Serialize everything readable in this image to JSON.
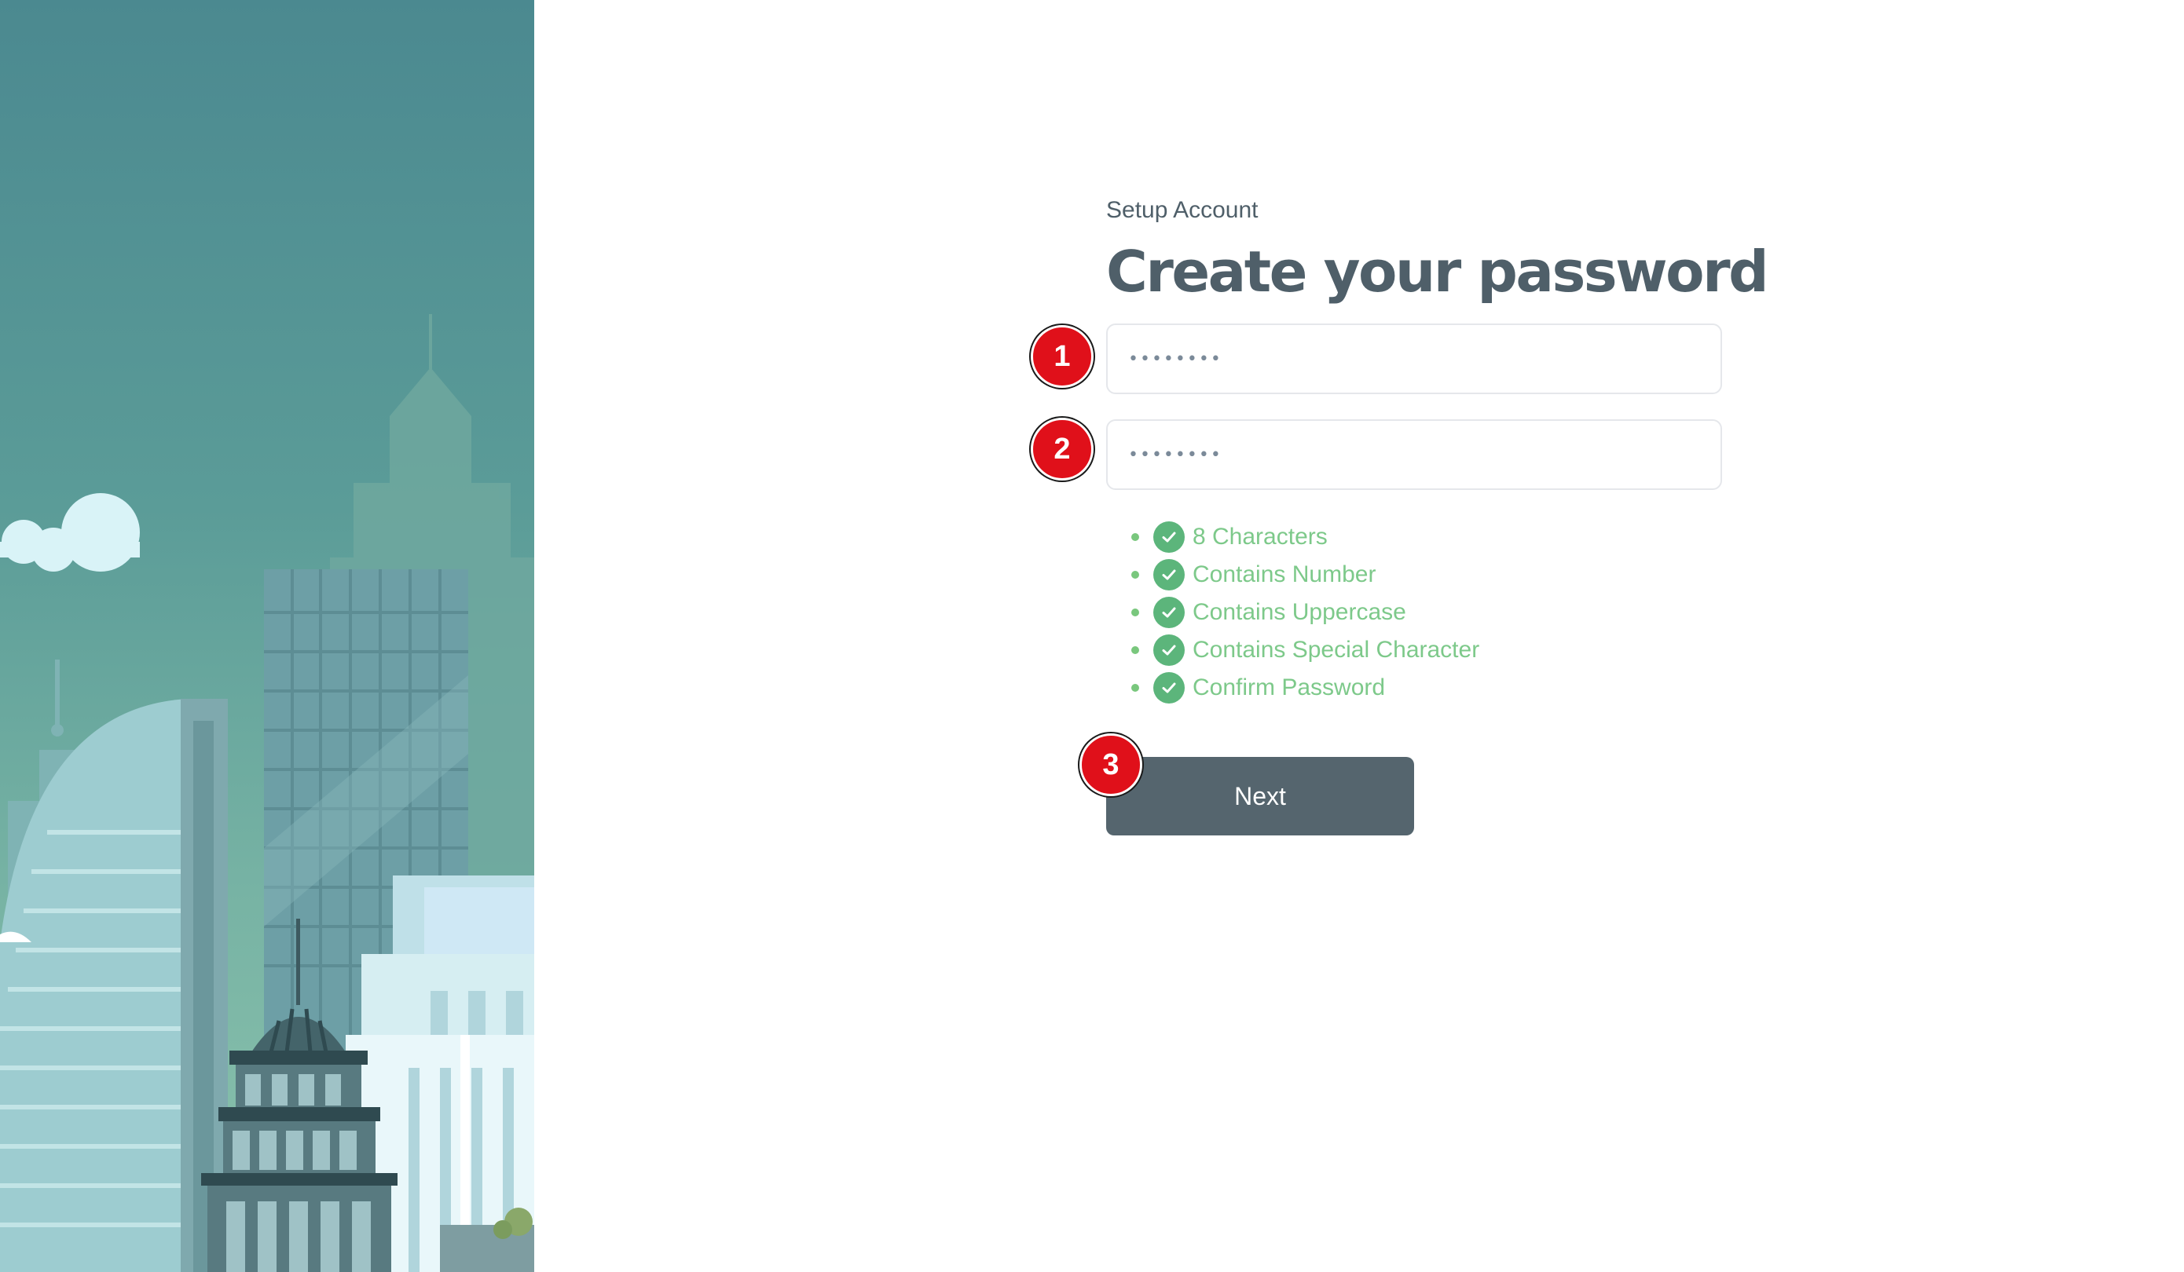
{
  "header": {
    "subtitle": "Setup Account",
    "title": "Create your password"
  },
  "fields": {
    "password_value": "••••••••",
    "confirm_value": "••••••••"
  },
  "requirements": [
    {
      "label": "8 Characters",
      "met": true
    },
    {
      "label": "Contains Number",
      "met": true
    },
    {
      "label": "Contains Uppercase",
      "met": true
    },
    {
      "label": "Contains Special Character",
      "met": true
    },
    {
      "label": "Confirm Password",
      "met": true
    }
  ],
  "actions": {
    "next_label": "Next"
  },
  "markers": [
    "1",
    "2",
    "3"
  ],
  "colors": {
    "primary": "#55656e",
    "heading": "#4f5f69",
    "success_text": "#7dc98a",
    "success_icon": "#5cb57b",
    "marker": "#e0101a"
  }
}
